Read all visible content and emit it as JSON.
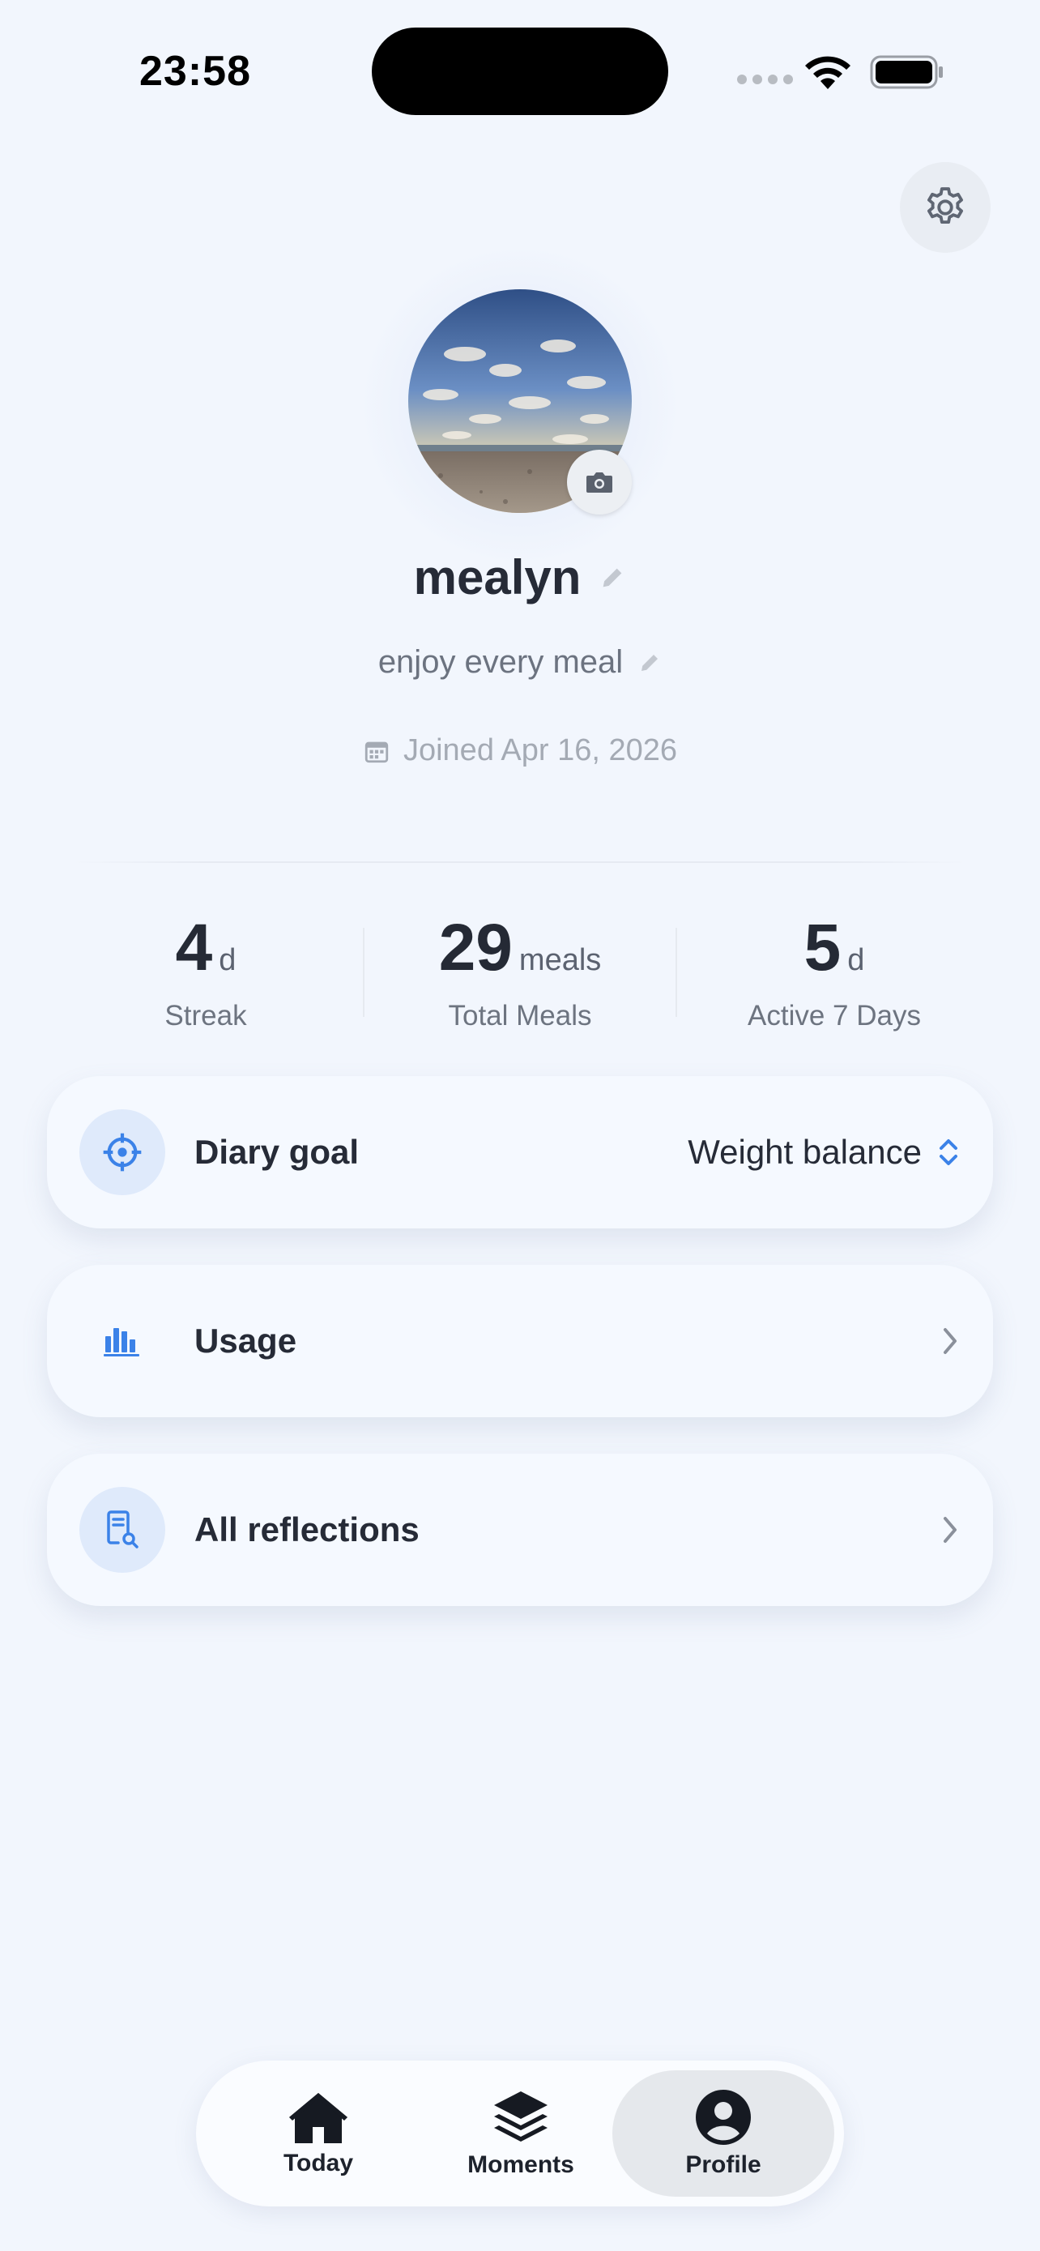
{
  "status_bar": {
    "time": "23:58"
  },
  "profile": {
    "username": "mealyn",
    "bio": "enjoy every meal",
    "joined": "Joined Apr 16, 2026"
  },
  "stats": [
    {
      "value": "4",
      "unit": "d",
      "label": "Streak"
    },
    {
      "value": "29",
      "unit": "meals",
      "label": "Total Meals"
    },
    {
      "value": "5",
      "unit": "d",
      "label": "Active 7 Days"
    }
  ],
  "cards": {
    "goal": {
      "title": "Diary goal",
      "value": "Weight balance"
    },
    "usage": {
      "title": "Usage"
    },
    "reflections": {
      "title": "All reflections"
    }
  },
  "tabbar": {
    "today": "Today",
    "moments": "Moments",
    "profile": "Profile"
  },
  "colors": {
    "background": "#f2f6fd",
    "accent": "#3b82e8",
    "active_tab": "#e5e8ec"
  },
  "icons": [
    "gear-icon",
    "camera-icon",
    "pencil-icon",
    "calendar-icon",
    "target-icon",
    "bar-chart-icon",
    "document-search-icon",
    "chevron-right-icon",
    "chevron-up-down-icon",
    "home-icon",
    "layers-icon",
    "user-circle-icon"
  ]
}
